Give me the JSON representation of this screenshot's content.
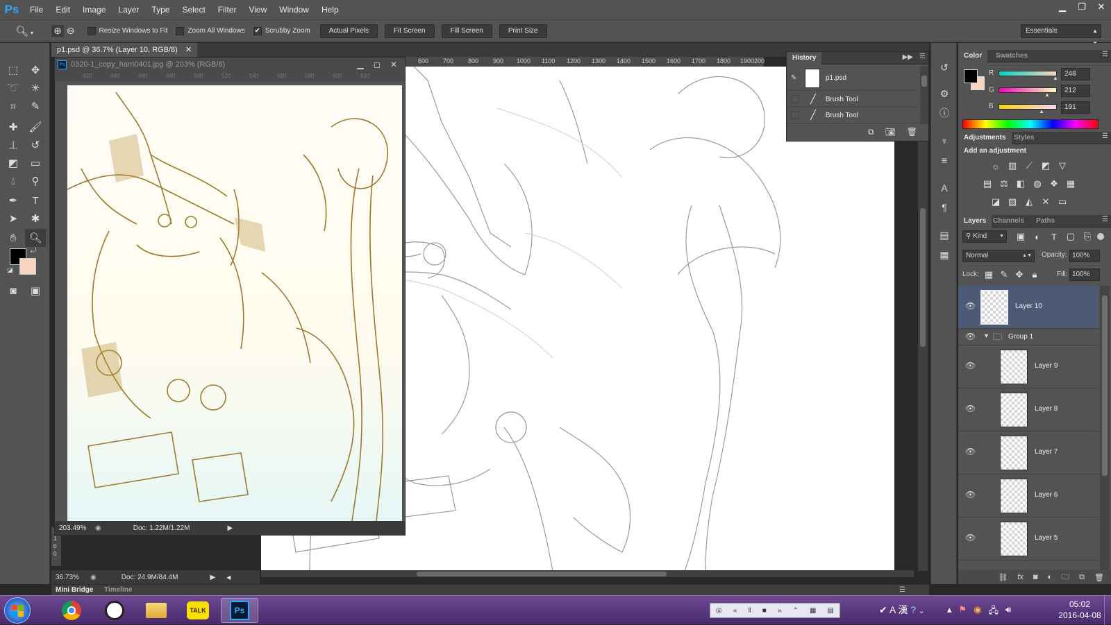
{
  "app": {
    "logo": "Ps",
    "menus": [
      "File",
      "Edit",
      "Image",
      "Layer",
      "Type",
      "Select",
      "Filter",
      "View",
      "Window",
      "Help"
    ]
  },
  "window_controls": [
    "minimize-icon",
    "restore-icon",
    "close-icon"
  ],
  "options_bar": {
    "tool_icon": "zoom-icon",
    "checks": [
      {
        "label": "Resize Windows to Fit",
        "checked": false
      },
      {
        "label": "Zoom All Windows",
        "checked": false
      },
      {
        "label": "Scrubby Zoom",
        "checked": true
      }
    ],
    "buttons": [
      "Actual Pixels",
      "Fit Screen",
      "Fill Screen",
      "Print Size"
    ],
    "workspace": "Essentials"
  },
  "document": {
    "tab_title": "p1.psd @ 36.7% (Layer 10, RGB/8)",
    "zoom": "36.73%",
    "doc_size": "Doc: 24.9M/84.4M",
    "ruler_ticks": [
      "600",
      "700",
      "800",
      "900",
      "1000",
      "1100",
      "1200",
      "1300",
      "1400",
      "1500",
      "1600",
      "1700",
      "1800",
      "1900",
      "200"
    ],
    "ruler_left_ticks": [
      "2",
      "1",
      "0",
      "0"
    ]
  },
  "float_document": {
    "title": "0320-1_copy_ham0401.jpg @ 203% (RGB/8)",
    "zoom": "203.49%",
    "doc_size": "Doc: 1.22M/1.22M",
    "ruler_ticks": [
      "420",
      "440",
      "460",
      "480",
      "500",
      "520",
      "540",
      "560",
      "580",
      "600",
      "620"
    ]
  },
  "history": {
    "tab": "History",
    "snapshot": "p1.psd",
    "states": [
      "Brush Tool",
      "Brush Tool"
    ]
  },
  "color_panel": {
    "tabs": [
      "Color",
      "Swatches"
    ],
    "channels": [
      {
        "label": "R",
        "value": "248"
      },
      {
        "label": "G",
        "value": "212"
      },
      {
        "label": "B",
        "value": "191"
      }
    ],
    "foreground": "#000000",
    "background": "#f8d4bf"
  },
  "adjustments": {
    "tabs": [
      "Adjustments",
      "Styles"
    ],
    "heading": "Add an adjustment"
  },
  "layers_panel": {
    "tabs": [
      "Layers",
      "Channels",
      "Paths"
    ],
    "filter_kind": "Kind",
    "blend_mode": "Normal",
    "opacity_label": "Opacity:",
    "opacity": "100%",
    "lock_label": "Lock:",
    "fill_label": "Fill:",
    "fill": "100%",
    "layers": [
      {
        "name": "Layer 10",
        "selected": true
      },
      {
        "name": "Group 1",
        "group": true
      },
      {
        "name": "Layer 9"
      },
      {
        "name": "Layer 8"
      },
      {
        "name": "Layer 7"
      },
      {
        "name": "Layer 6"
      },
      {
        "name": "Layer 5"
      }
    ]
  },
  "bottom_tabs": [
    "Mini Bridge",
    "Timeline"
  ],
  "taskbar": {
    "apps": [
      "chrome-icon",
      "panda-app-icon",
      "file-explorer-icon",
      "kakaotalk-icon",
      "photoshop-icon"
    ],
    "kakao_label": "TALK",
    "ps_label": "Ps",
    "ime": "A 漢",
    "time": "05:02",
    "date": "2016-04-08"
  },
  "colors": {
    "accent": "#31a8ff",
    "panel": "#535353",
    "dark": "#282828",
    "selected_layer": "#4d5a76",
    "taskbar": "#55357a"
  }
}
